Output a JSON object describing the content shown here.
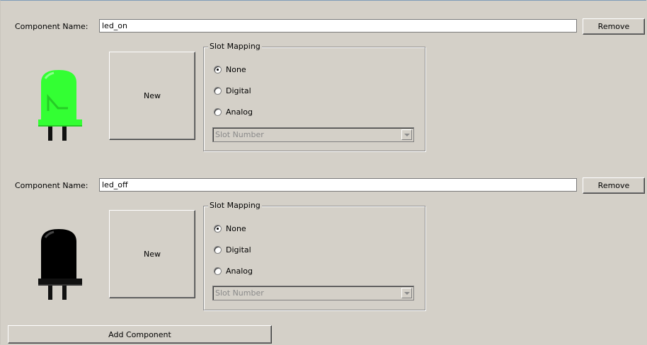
{
  "components": [
    {
      "label": "Component Name:",
      "name_value": "led_on",
      "remove_label": "Remove",
      "new_label": "New",
      "icon": "led-on-icon",
      "led_color": "#33ff33",
      "slot_mapping": {
        "title": "Slot Mapping",
        "options": [
          "None",
          "Digital",
          "Analog"
        ],
        "selected": "None",
        "slot_placeholder": "Slot Number"
      }
    },
    {
      "label": "Component Name:",
      "name_value": "led_off",
      "remove_label": "Remove",
      "new_label": "New",
      "icon": "led-off-icon",
      "led_color": "#000000",
      "slot_mapping": {
        "title": "Slot Mapping",
        "options": [
          "None",
          "Digital",
          "Analog"
        ],
        "selected": "None",
        "slot_placeholder": "Slot Number"
      }
    }
  ],
  "add_component_label": "Add Component"
}
